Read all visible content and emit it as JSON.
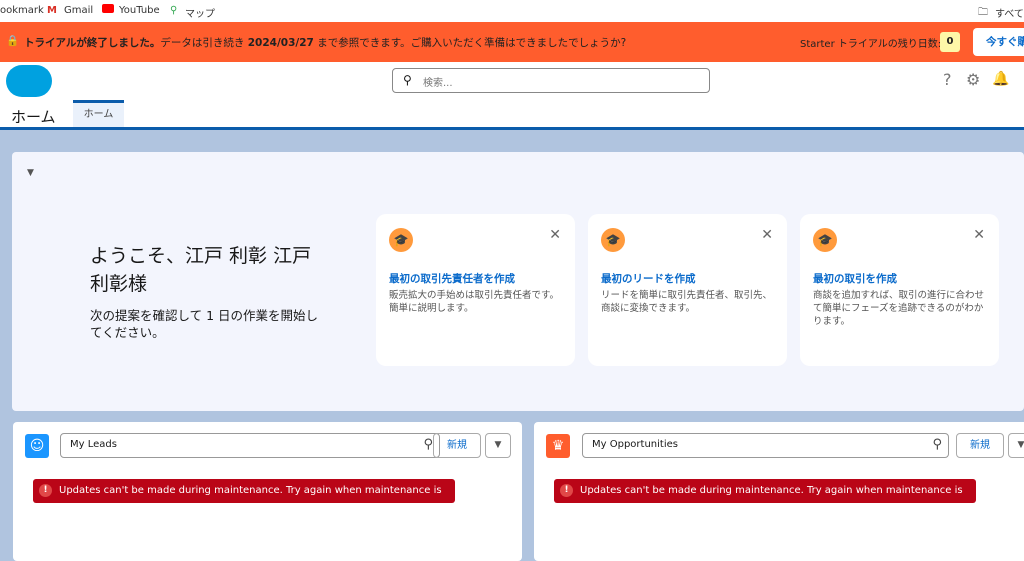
{
  "bookmarks": [
    "ookmark",
    "Gmail",
    "YouTube",
    "マップ"
  ],
  "bookmarks_right": "すべての",
  "banner": {
    "bold": "トライアルが終了しました。",
    "text1": "データは引き続き",
    "date": "2024/03/27",
    "text2": "まで参照できます。ご購入いただく準備はできましたでしょうか?",
    "remaining_label": "Starter トライアルの残り日数:",
    "remaining_days": "0",
    "buy_button": "今すぐ購"
  },
  "header": {
    "search_placeholder": "検索..."
  },
  "nav": {
    "app_name": "ホーム",
    "tabs": [
      "ホーム"
    ]
  },
  "welcome": {
    "title": "ようこそ、江戸 利彰 江戸 利彰様",
    "subtitle": "次の提案を確認して 1 日の作業を開始してください。",
    "cards": [
      {
        "title": "最初の取引先責任者を作成",
        "desc": "販売拡大の手始めは取引先責任者です。簡単に説明します。"
      },
      {
        "title": "最初のリードを作成",
        "desc": "リードを簡単に取引先責任者、取引先、商談に変換できます。"
      },
      {
        "title": "最初の取引を作成",
        "desc": "商談を追加すれば、取引の進行に合わせて簡単にフェーズを追跡できるのがわかります。"
      }
    ]
  },
  "panels": [
    {
      "list_view": "My Leads",
      "new_button": "新規",
      "error": "Updates can't be made during maintenance. Try again when maintenance is complete.",
      "icon_color": "#1b96ff"
    },
    {
      "list_view": "My Opportunities",
      "new_button": "新規",
      "error": "Updates can't be made during maintenance. Try again when maintenance is complete.",
      "icon_color": "#ff5d2d"
    }
  ]
}
